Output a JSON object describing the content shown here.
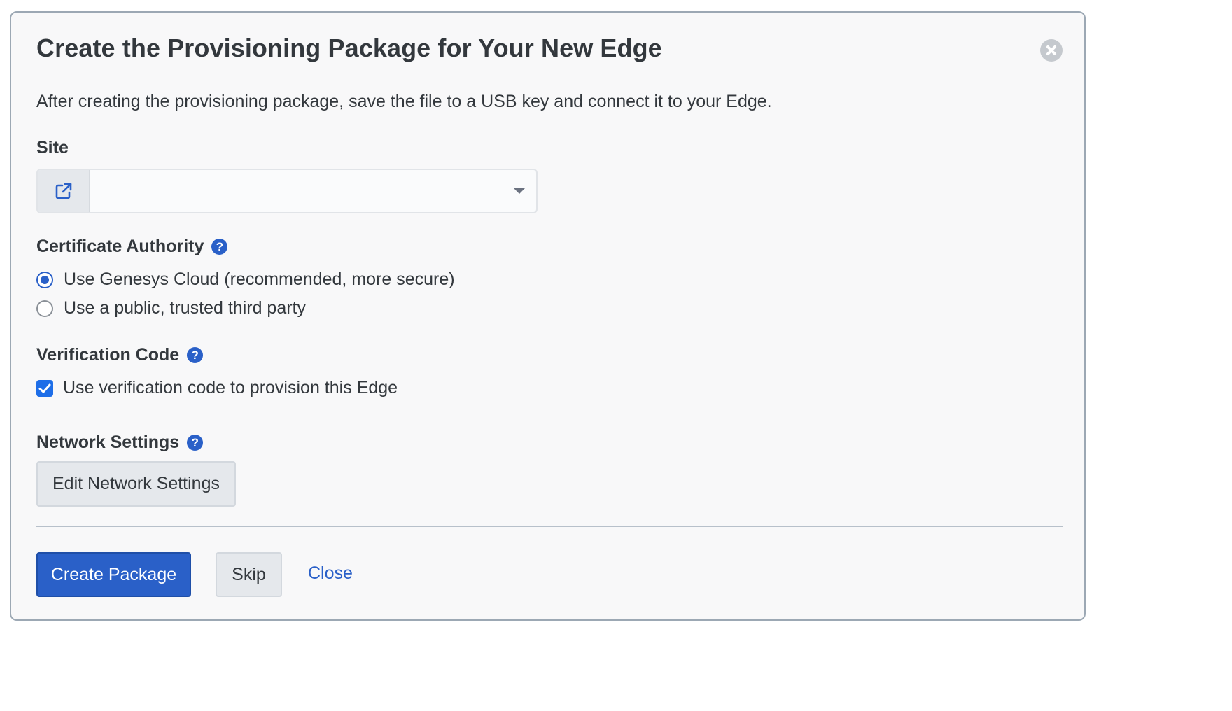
{
  "dialog": {
    "title": "Create the Provisioning Package for Your New Edge",
    "description": "After creating the provisioning package, save the file to a USB key and connect it to your Edge."
  },
  "site": {
    "label": "Site",
    "value": "",
    "addon_icon": "external-link-icon"
  },
  "certificate_authority": {
    "label": "Certificate Authority",
    "options": [
      {
        "label": "Use Genesys Cloud (recommended, more secure)",
        "selected": true
      },
      {
        "label": "Use a public, trusted third party",
        "selected": false
      }
    ]
  },
  "verification_code": {
    "label": "Verification Code",
    "checkbox_label": "Use verification code to provision this Edge",
    "checked": true
  },
  "network_settings": {
    "label": "Network Settings",
    "button_label": "Edit Network Settings"
  },
  "footer": {
    "create_label": "Create Package",
    "skip_label": "Skip",
    "close_label": "Close"
  },
  "colors": {
    "primary": "#2a60c8",
    "text": "#33383d",
    "background": "#f8f8f9"
  }
}
